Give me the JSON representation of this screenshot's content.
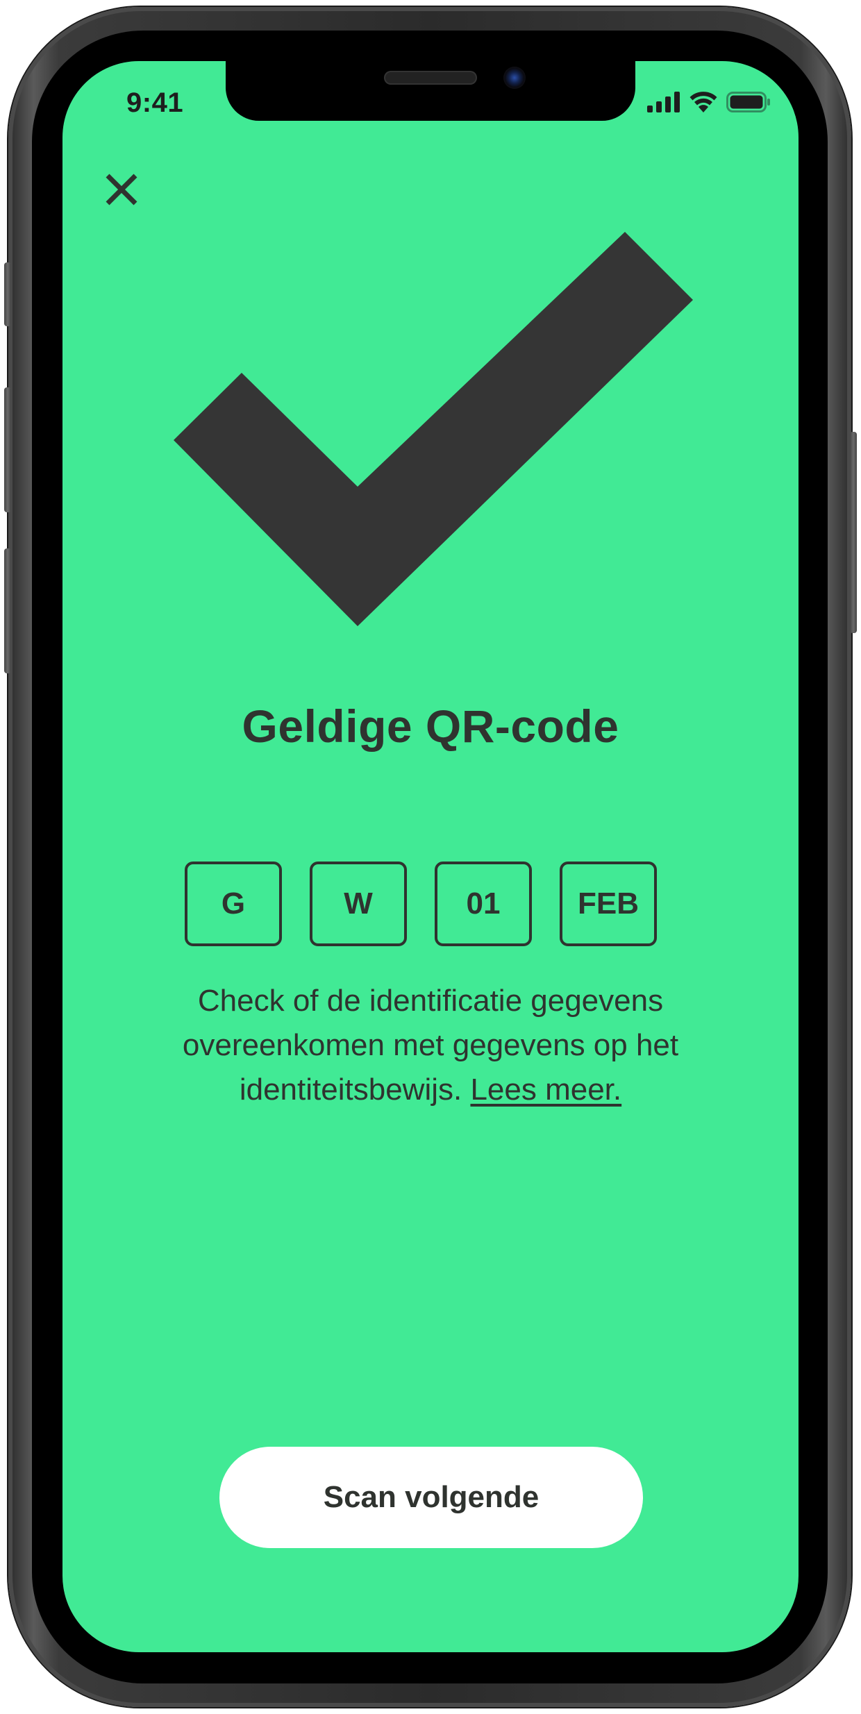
{
  "status_bar": {
    "time": "9:41",
    "signal_icon": "cellular-signal-icon",
    "wifi_icon": "wifi-icon",
    "battery_icon": "battery-icon"
  },
  "header": {
    "close_icon": "close-icon"
  },
  "result": {
    "icon": "checkmark-icon",
    "title": "Geldige QR-code"
  },
  "identity_codes": [
    "G",
    "W",
    "01",
    "FEB"
  ],
  "description": {
    "text": "Check of de identificatie gegevens overeenkomen met gegevens op het identiteitsbewijs.",
    "link_label": "Lees meer."
  },
  "actions": {
    "scan_next_label": "Scan volgende"
  },
  "colors": {
    "screen_background": "#41ea95",
    "foreground": "#2f332f",
    "button_background": "#ffffff"
  }
}
